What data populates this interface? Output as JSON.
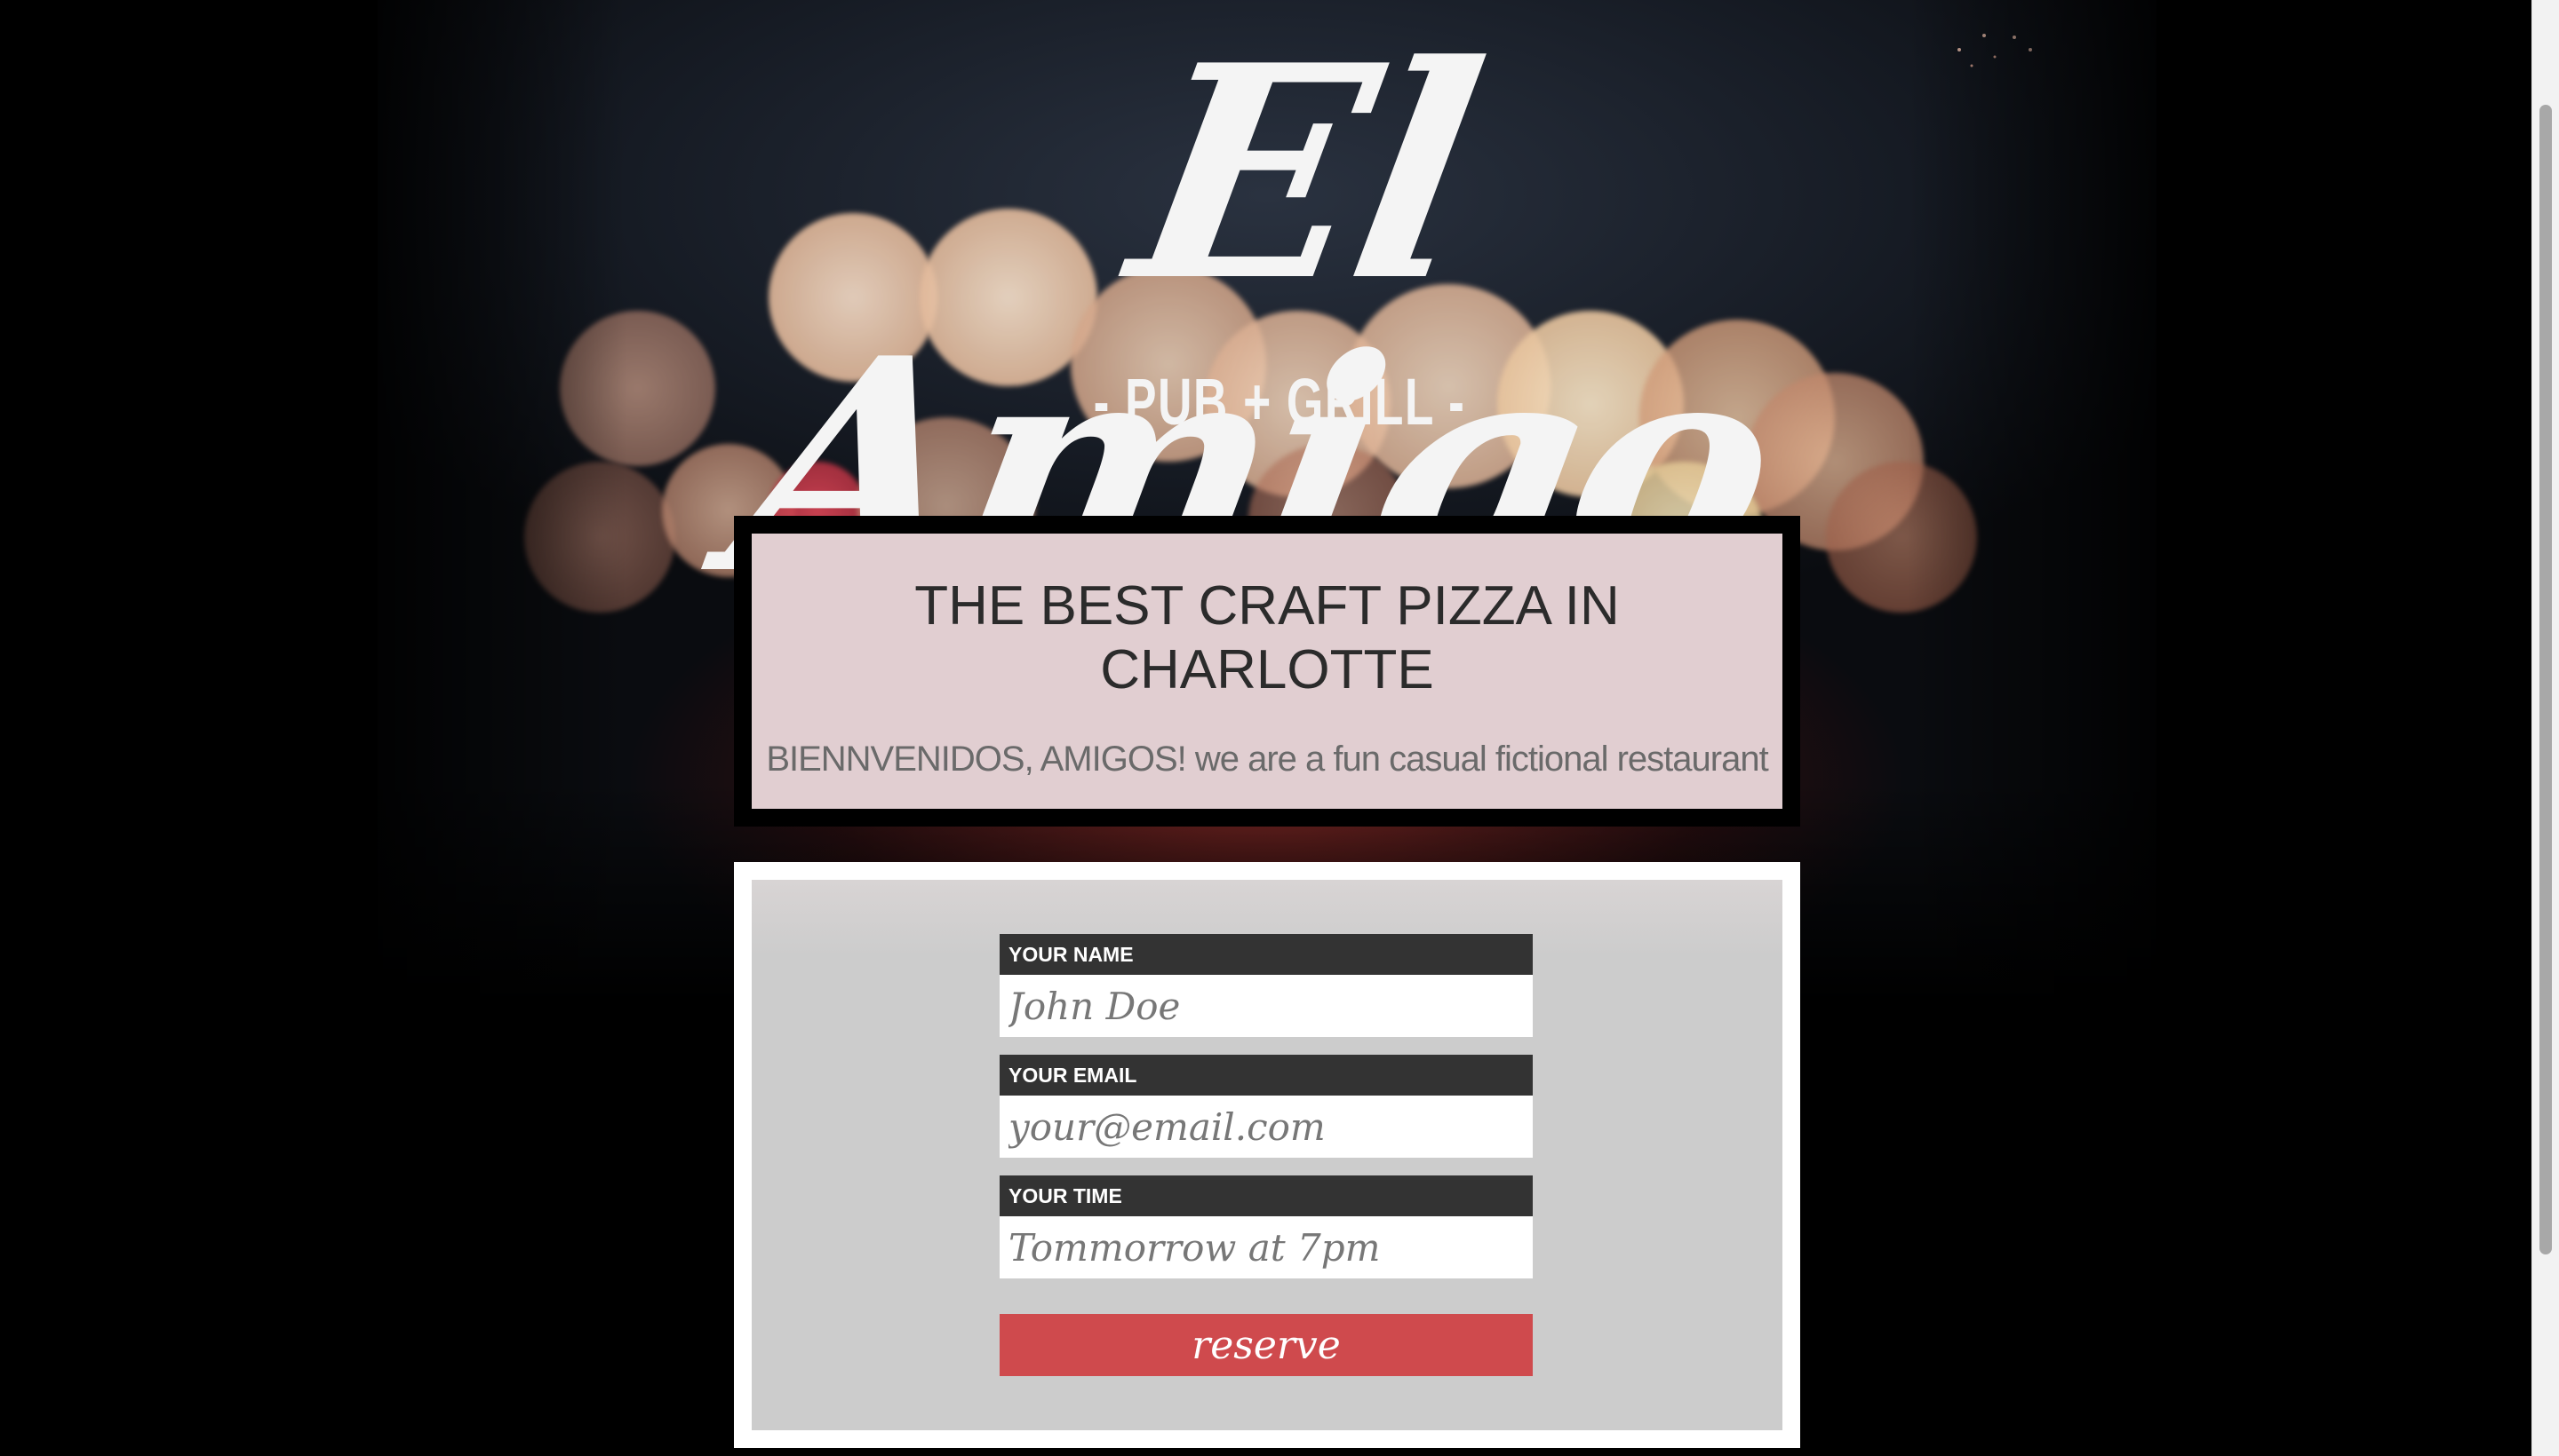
{
  "logo": {
    "script": "El Amigo",
    "tagline": "- PUB + GRILL -"
  },
  "welcome": {
    "title": "THE BEST CRAFT PIZZA IN CHARLOTTE",
    "subtitle": "BIENNVENIDOS, AMIGOS! we are a fun casual fictional restaurant"
  },
  "form": {
    "name": {
      "label": "YOUR NAME",
      "placeholder": "John Doe",
      "value": ""
    },
    "email": {
      "label": "YOUR EMAIL",
      "placeholder": "your@email.com",
      "value": ""
    },
    "time": {
      "label": "YOUR TIME",
      "placeholder": "Tommorrow at 7pm",
      "value": ""
    },
    "submit_label": "reserve"
  },
  "colors": {
    "accent": "#cf4a4d",
    "label_bg": "#333333",
    "form_bg": "#cccccc"
  }
}
